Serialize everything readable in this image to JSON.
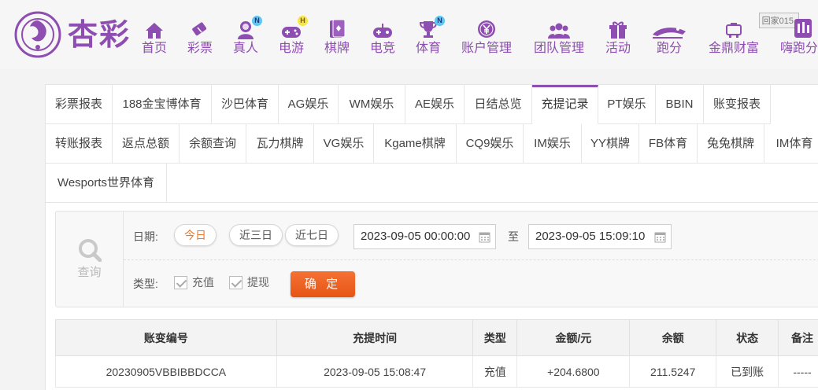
{
  "brand": {
    "name": "杏彩"
  },
  "nav": [
    {
      "label": "首页",
      "icon": "home-icon"
    },
    {
      "label": "彩票",
      "icon": "lottery-ticket-icon"
    },
    {
      "label": "真人",
      "icon": "live-dealer-icon",
      "badge": "N"
    },
    {
      "label": "电游",
      "icon": "gamepad-icon",
      "badge": "H"
    },
    {
      "label": "棋牌",
      "icon": "cards-icon"
    },
    {
      "label": "电竞",
      "icon": "esports-controller-icon"
    },
    {
      "label": "体育",
      "icon": "trophy-icon",
      "badge": "N"
    },
    {
      "label": "账户管理",
      "icon": "account-yen-icon"
    },
    {
      "label": "团队管理",
      "icon": "team-icon"
    },
    {
      "label": "活动",
      "icon": "gift-icon"
    },
    {
      "label": "跑分",
      "icon": "running-icon"
    },
    {
      "label": "金鼎财富",
      "icon": "treasure-icon"
    },
    {
      "label": "嗨跑分",
      "icon": "app-icon"
    }
  ],
  "watermark": "回家015.",
  "tabs": {
    "row1": [
      "彩票报表",
      "188金宝博体育",
      "沙巴体育",
      "AG娱乐",
      "WM娱乐",
      "AE娱乐",
      "日结总览",
      "充提记录",
      "PT娱乐",
      "BBIN",
      "账变报表"
    ],
    "row2": [
      "转账报表",
      "返点总额",
      "余额查询",
      "瓦力棋牌",
      "VG娱乐",
      "Kgame棋牌",
      "CQ9娱乐",
      "IM娱乐",
      "YY棋牌",
      "FB体育",
      "兔兔棋牌",
      "IM体育"
    ],
    "row3": [
      "Wesports世界体育"
    ],
    "active": "充提记录"
  },
  "filter": {
    "query_label": "查询",
    "date_label": "日期:",
    "quick_ranges": [
      "今日",
      "近三日",
      "近七日"
    ],
    "active_range": "今日",
    "start": "2023-09-05 00:00:00",
    "to_label": "至",
    "end": "2023-09-05 15:09:10",
    "type_label": "类型:",
    "types": [
      "充值",
      "提现"
    ],
    "confirm_label": "确 定"
  },
  "table": {
    "headers": [
      "账变编号",
      "充提时间",
      "类型",
      "金额/元",
      "余额",
      "状态",
      "备注"
    ],
    "rows": [
      [
        "20230905VBBIBBDCCA",
        "2023-09-05 15:08:47",
        "充值",
        "+204.6800",
        "211.5247",
        "已到账",
        "-----"
      ]
    ]
  },
  "colors": {
    "brand": "#8e4db0",
    "accent": "#e8772a",
    "confirm": "#f06a2a",
    "amount": "#d12b2b",
    "success": "#2e9a2e"
  }
}
